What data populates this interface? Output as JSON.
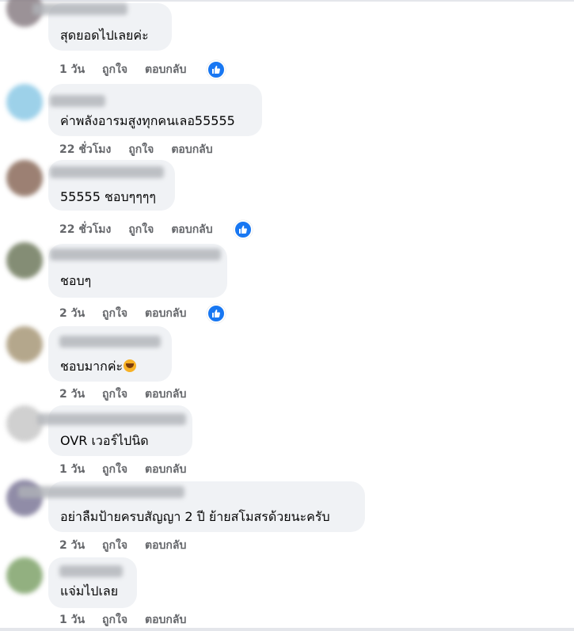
{
  "colors": {
    "bubble": "#f0f2f5",
    "meta": "#65676b",
    "like_blue": "#1877f2"
  },
  "comments": [
    {
      "text": "สุดยอดไปเลยค่ะ",
      "time": "1 วัน",
      "like": "ถูกใจ",
      "reply": "ตอบกลับ",
      "reacted": true
    },
    {
      "text": "ค่าพลังอารมสูงทุกคนเลอ55555",
      "time": "22 ชั่วโมง",
      "like": "ถูกใจ",
      "reply": "ตอบกลับ",
      "reacted": false
    },
    {
      "text": "55555 ชอบๆๆๆๆ",
      "time": "22 ชั่วโมง",
      "like": "ถูกใจ",
      "reply": "ตอบกลับ",
      "reacted": true
    },
    {
      "text": "ชอบๆ",
      "time": "2 วัน",
      "like": "ถูกใจ",
      "reply": "ตอบกลับ",
      "reacted": true
    },
    {
      "text": "ชอบมากค่ะ",
      "emoji": "rolling-on-floor-laughing-icon",
      "time": "2 วัน",
      "like": "ถูกใจ",
      "reply": "ตอบกลับ",
      "reacted": false
    },
    {
      "text": "OVR เวอร์ไปนิด",
      "time": "1 วัน",
      "like": "ถูกใจ",
      "reply": "ตอบกลับ",
      "reacted": false
    },
    {
      "text": "อย่าลืมป้ายครบสัญญา 2 ปี ย้ายสโมสรด้วยนะครับ",
      "time": "2 วัน",
      "like": "ถูกใจ",
      "reply": "ตอบกลับ",
      "reacted": false
    },
    {
      "text": "แจ่มไปเลย",
      "time": "1 วัน",
      "like": "ถูกใจ",
      "reply": "ตอบกลับ",
      "reacted": false
    }
  ]
}
